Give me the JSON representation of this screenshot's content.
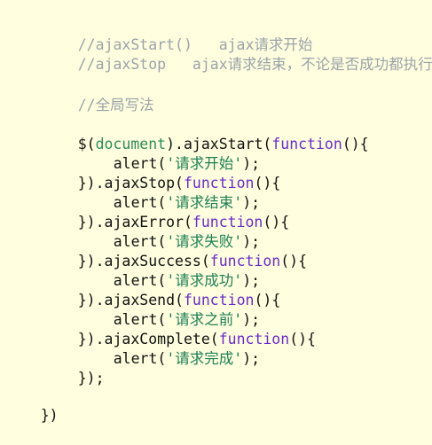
{
  "code": {
    "comment_start": "//ajaxStart()   ajax请求开始",
    "comment_stop": "//ajaxStop   ajax请求结束，不论是否成功都执行",
    "comment_global": "//全局写法",
    "t_dollar": "$(",
    "t_document": "document",
    "t_ajaxStart_call": ").ajaxStart(",
    "t_function": "function",
    "t_paren_open": "(){",
    "t_alert_open": "alert(",
    "s_start": "'请求开始'",
    "t_alert_close": ");",
    "t_close_stop": "}).ajaxStop(",
    "s_end": "'请求结束'",
    "t_close_error": "}).ajaxError(",
    "s_fail": "'请求失败'",
    "t_close_success": "}).ajaxSuccess(",
    "s_success": "'请求成功'",
    "t_close_send": "}).ajaxSend(",
    "s_before": "'请求之前'",
    "t_close_complete": "}).ajaxComplete(",
    "s_complete": "'请求完成'",
    "t_end_chain": "});",
    "t_end_outer": "})"
  }
}
